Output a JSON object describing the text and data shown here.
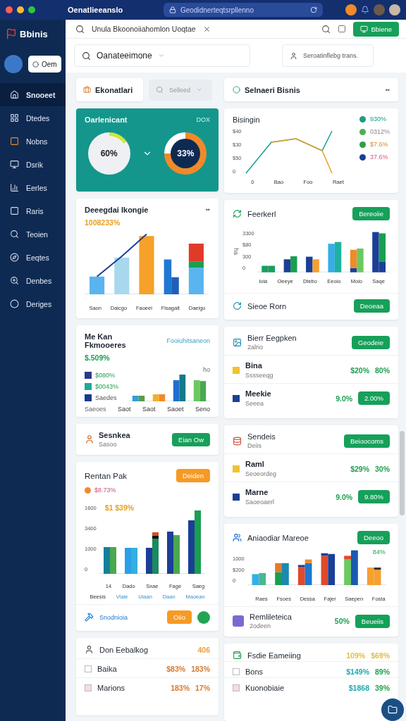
{
  "browser": {
    "title": "Oenatlieeanslo",
    "url": "Geodidnerteqtsrpllenno"
  },
  "sidebar": {
    "brand": "Bbinis",
    "account_button": "Oem",
    "items": [
      {
        "label": "Snooeet",
        "selected": true
      },
      {
        "label": "Dtedes",
        "selected": false
      },
      {
        "label": "Nobns",
        "selected": false
      },
      {
        "label": "Dsrik",
        "selected": false
      },
      {
        "label": "Eerles",
        "selected": false
      },
      {
        "label": "Raris",
        "selected": false
      },
      {
        "label": "Teoien",
        "selected": false
      },
      {
        "label": "Eeqtes",
        "selected": false
      },
      {
        "label": "Denbes",
        "selected": false
      },
      {
        "label": "Deriges",
        "selected": false
      }
    ]
  },
  "topbar": {
    "search": "Unula Bkoonoiiahomlon Uoqtae",
    "button": "Bbiene"
  },
  "filters": {
    "search": "Oanateeimone",
    "select": "Seroatinflebg trans."
  },
  "left": {
    "tab": {
      "label": "Ekonatlari"
    },
    "select": {
      "placeholder": "Selleed"
    },
    "conversion": {
      "title": "Oarlenicant",
      "tag": "DOX",
      "from": {
        "reading": "60%"
      },
      "to": {
        "reading": "33%"
      }
    },
    "combo": {
      "title": "Deeegdai Ikongie",
      "menu": "••",
      "value": "1008233%",
      "categories": [
        "Saon",
        "Daicgo",
        "Faoeei",
        "Fisagait",
        "Daeigo"
      ]
    },
    "kpi": {
      "title": "Me Kan Fkmooeres",
      "link": "Fooiuhitsaneon",
      "value": "$.509%",
      "axis_label": "ho",
      "legend": [
        {
          "label": "$080%",
          "color": "#2b3a8f"
        },
        {
          "label": "$0043%",
          "color": "#1fa89a"
        },
        {
          "label": "Saedes",
          "color": "#17398f"
        }
      ],
      "note": "Saeoes",
      "categories": [
        "Saot",
        "Saot",
        "Saoet",
        "Seno"
      ]
    },
    "contact": {
      "title": "Sesnkea",
      "subtitle": "Sasoo",
      "button": "Eian Ow"
    },
    "rental": {
      "title": "Rentan Pak",
      "button": "Deiden",
      "value": "$8.73%",
      "highlight": "$1 $39%",
      "yticks": [
        "1600",
        "3400",
        "1000",
        "0"
      ],
      "categories": [
        "14",
        "Dado",
        "Sxae",
        "Fage",
        "Saeg"
      ],
      "labels": [
        "Beesis",
        "Vlaie",
        "Ulaan",
        "Daan",
        "Maoean"
      ],
      "footer": {
        "label": "Snodnioia",
        "button": "Oiio",
        "toggle_on": true
      }
    },
    "ranking": {
      "title": "Don Eebalkog",
      "value": "406",
      "rows": [
        {
          "label": "Baika",
          "value": "$83%",
          "change": "183%"
        },
        {
          "label": "Marions",
          "value": "183%",
          "change": "17%"
        }
      ]
    }
  },
  "right": {
    "header": {
      "title": "Selnaeri Bisnis",
      "menu": "••"
    },
    "line": {
      "title": "Bisingin",
      "yticks": [
        "$40",
        "$30",
        "$50",
        "0"
      ],
      "xticks": [
        "0",
        "Bao",
        "Foo",
        "Raet"
      ],
      "legend": [
        {
          "label": "930%",
          "color": "#1a9e80"
        },
        {
          "label": "0312%",
          "color": "#4cb050"
        },
        {
          "label": "$7.6%",
          "color": "#2ea044"
        },
        {
          "label": "37.6%",
          "color": "#1b3e96"
        }
      ]
    },
    "stacked": {
      "title": "Feerkerl",
      "button": "Bereoiie",
      "ylabel": "ha",
      "yticks": [
        "3300",
        "$80",
        "300",
        "0"
      ],
      "categories": [
        "Ioia",
        "Oeeye",
        "Dtebo",
        "Eeoio",
        "Moio",
        "Saqe"
      ],
      "footer": {
        "label": "Sieoe Rorn",
        "button": "Deoeaa"
      }
    },
    "team": {
      "title": "Bierr Eegpken",
      "subtitle": "2alrio",
      "button": "Geodeie",
      "rows": [
        {
          "label": "Bina",
          "sub": "Sssseeqg",
          "value": "$20%",
          "change": "80%",
          "kind": "text"
        },
        {
          "label": "Meekie",
          "sub": "Seeea",
          "value": "9.0%",
          "change": "2.00%",
          "kind": "button"
        }
      ]
    },
    "sales": {
      "title": "Sendeis",
      "subtitle": "Deiis",
      "button": "Beioocoms",
      "rows": [
        {
          "label": "Raml",
          "sub": "Seoeordeg",
          "value": "$29%",
          "change": "30%",
          "kind": "text"
        },
        {
          "label": "Marne",
          "sub": "Saoeoaerl",
          "value": "9.0%",
          "change": "9.80%",
          "kind": "button"
        }
      ]
    },
    "market": {
      "title": "Aniaodiar Mareoe",
      "button": "Deeoo",
      "yticks": [
        "1000",
        "$200",
        "0"
      ],
      "badge": "84%",
      "categories": [
        "Raes",
        "Fsoes",
        "Dessa",
        "Fajer",
        "Saepen",
        "Fosta"
      ],
      "footer": {
        "title": "Remlileteica",
        "subtitle": "2odeen",
        "value": "50%",
        "button": "Beueiis"
      }
    },
    "earnings": {
      "title": "Fsdie Eameiing",
      "value": "109%",
      "change": "$69%",
      "rows": [
        {
          "label": "Bons",
          "value": "$149%",
          "change": "89%"
        },
        {
          "label": "Kuonobiaie",
          "value": "$1868",
          "change": "39%"
        }
      ]
    }
  }
}
